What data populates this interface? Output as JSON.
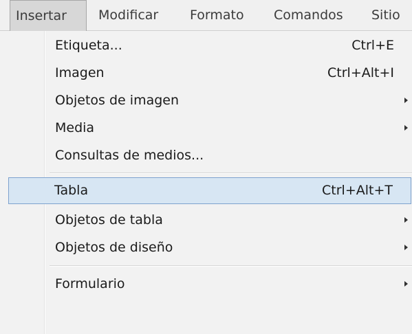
{
  "menubar": {
    "items": [
      {
        "label": "Insertar",
        "open": true
      },
      {
        "label": "Modificar"
      },
      {
        "label": "Formato"
      },
      {
        "label": "Comandos"
      },
      {
        "label": "Sitio"
      }
    ]
  },
  "menu": {
    "items": [
      {
        "label": "Etiqueta...",
        "shortcut": "Ctrl+E"
      },
      {
        "label": "Imagen",
        "shortcut": "Ctrl+Alt+I"
      },
      {
        "label": "Objetos de imagen",
        "submenu": true
      },
      {
        "label": "Media",
        "submenu": true
      },
      {
        "label": "Consultas de medios..."
      },
      {
        "label": "Tabla",
        "shortcut": "Ctrl+Alt+T",
        "highlighted": true
      },
      {
        "label": "Objetos de tabla",
        "submenu": true
      },
      {
        "label": "Objetos de diseño",
        "submenu": true
      },
      {
        "label": "Formulario",
        "submenu": true
      }
    ]
  },
  "colors": {
    "highlight_bg": "#d7e6f3",
    "highlight_border": "#7da2ce",
    "menubar_bg": "#f0f0f0",
    "menu_bg": "#f2f2f2"
  }
}
